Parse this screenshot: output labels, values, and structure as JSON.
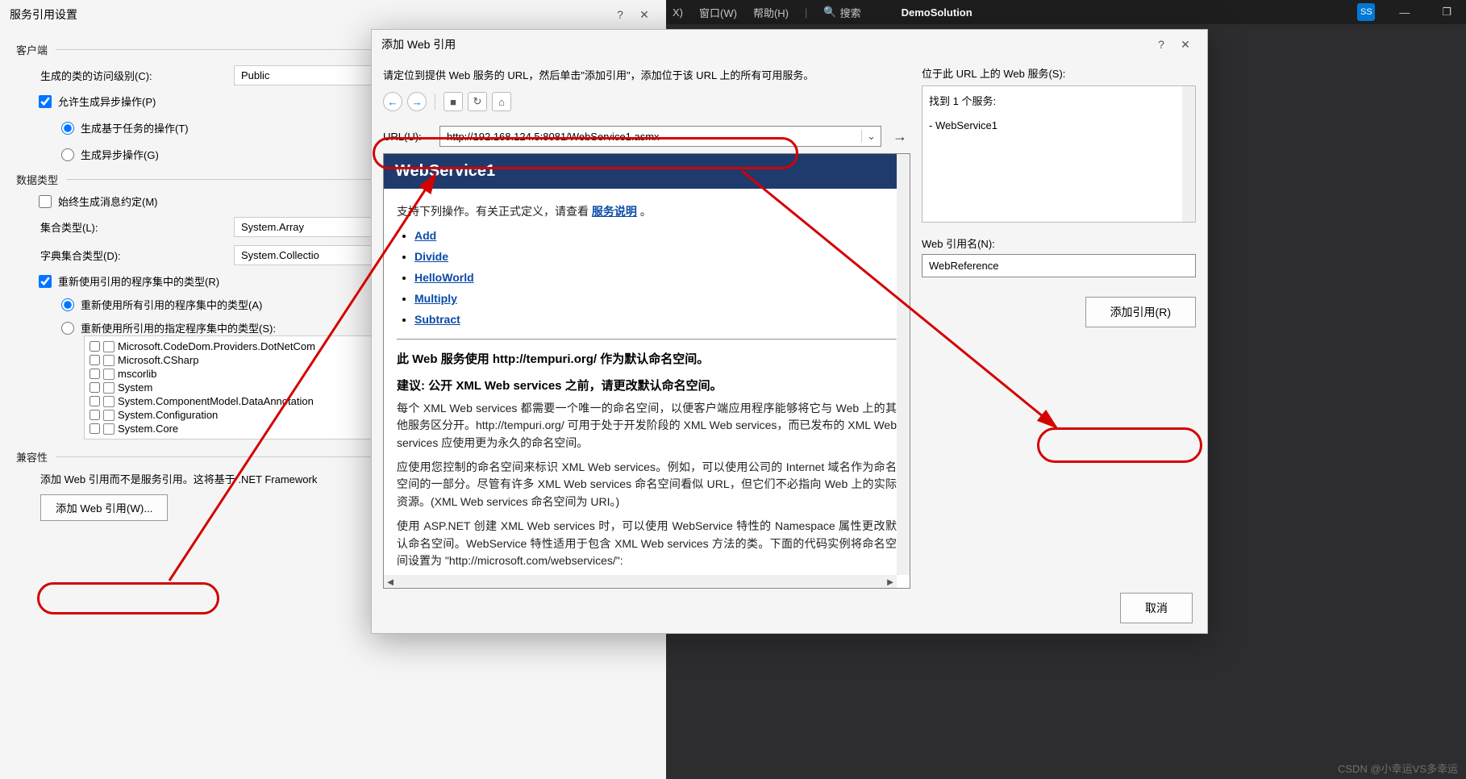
{
  "vs": {
    "menu_x": "X)",
    "menu_window": "窗口(W)",
    "menu_help": "帮助(H)",
    "search_label": "搜索",
    "solution": "DemoSolution",
    "avatar": "SS"
  },
  "settings": {
    "title": "服务引用设置",
    "group_client": "客户端",
    "access_label": "生成的类的访问级别(C):",
    "access_value": "Public",
    "allow_async_label": "允许生成异步操作(P)",
    "task_based_label": "生成基于任务的操作(T)",
    "gen_async_label": "生成异步操作(G)",
    "group_data": "数据类型",
    "always_msg_label": "始终生成消息约定(M)",
    "coll_type_label": "集合类型(L):",
    "coll_type_value": "System.Array",
    "dict_type_label": "字典集合类型(D):",
    "dict_type_value": "System.Collectio",
    "reuse_label": "重新使用引用的程序集中的类型(R)",
    "reuse_all_label": "重新使用所有引用的程序集中的类型(A)",
    "reuse_spec_label": "重新使用所引用的指定程序集中的类型(S):",
    "assemblies": [
      "Microsoft.CodeDom.Providers.DotNetCom",
      "Microsoft.CSharp",
      "mscorlib",
      "System",
      "System.ComponentModel.DataAnnotation",
      "System.Configuration",
      "System.Core"
    ],
    "group_compat": "兼容性",
    "compat_text": "添加 Web 引用而不是服务引用。这将基于 .NET Framework",
    "add_webref_btn": "添加 Web 引用(W)..."
  },
  "webref": {
    "title": "添加 Web 引用",
    "instr": "请定位到提供 Web 服务的 URL，然后单击\"添加引用\"，添加位于该 URL 上的所有可用服务。",
    "url_label": "URL(U):",
    "url_value": "http://192.168.124.5:8081/WebService1.asmx",
    "go_arrow": "→",
    "ws_title": "WebService1",
    "ops_intro_a": "支持下列操作。有关正式定义，请查看",
    "ops_intro_link": "服务说明",
    "ops_intro_b": "。",
    "ops": [
      "Add",
      "Divide",
      "HelloWorld",
      "Multiply",
      "Subtract"
    ],
    "ns_h1": "此 Web 服务使用 http://tempuri.org/ 作为默认命名空间。",
    "ns_h2": "建议: 公开 XML Web services 之前，请更改默认命名空间。",
    "ns_p1": "每个 XML Web services 都需要一个唯一的命名空间，以便客户端应用程序能够将它与 Web 上的其他服务区分开。http://tempuri.org/ 可用于处于开发阶段的 XML Web services，而已发布的 XML Web services 应使用更为永久的命名空间。",
    "ns_p2": "应使用您控制的命名空间来标识 XML Web services。例如，可以使用公司的 Internet 域名作为命名空间的一部分。尽管有许多 XML Web services 命名空间看似 URL，但它们不必指向 Web 上的实际资源。(XML Web services 命名空间为 URI。)",
    "ns_p3": "使用 ASP.NET 创建 XML Web services 时，可以使用 WebService 特性的 Namespace 属性更改默认命名空间。WebService 特性适用于包含 XML Web services 方法的类。下面的代码实例将命名空间设置为 \"http://microsoft.com/webservices/\":",
    "found_label": "位于此 URL 上的 Web 服务(S):",
    "found_count": "找到 1 个服务:",
    "found_item": "- WebService1",
    "refname_label": "Web 引用名(N):",
    "refname_value": "WebReference",
    "add_btn": "添加引用(R)",
    "cancel_btn": "取消"
  },
  "watermark": "CSDN @小幸运VS多幸运"
}
